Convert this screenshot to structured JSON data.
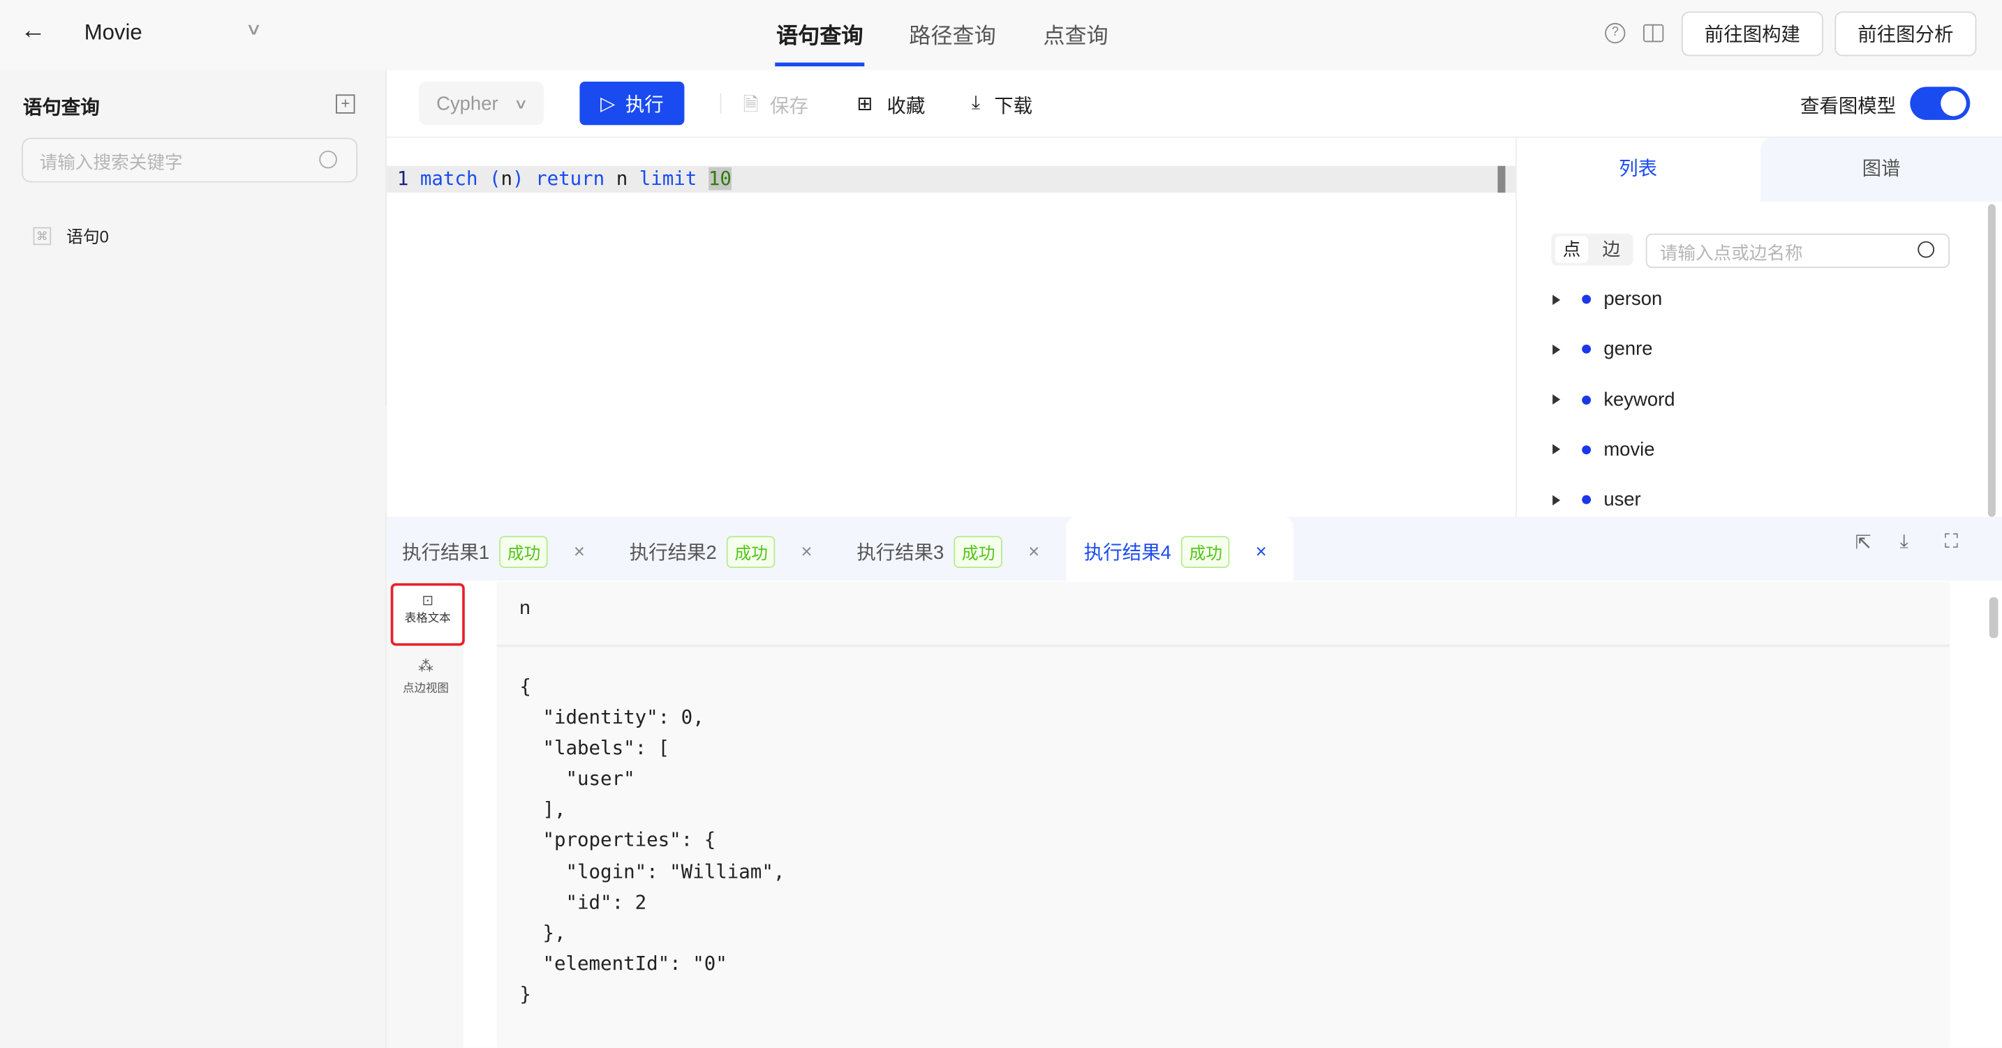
{
  "header": {
    "back_icon": "arrow-left-icon",
    "graph_name": "Movie",
    "tabs": [
      {
        "label": "语句查询",
        "active": true
      },
      {
        "label": "路径查询",
        "active": false
      },
      {
        "label": "点查询",
        "active": false
      }
    ],
    "help_icon": "question-circle-icon",
    "layout_icon": "split-layout-icon",
    "goto_build": "前往图构建",
    "goto_analysis": "前往图分析"
  },
  "sidebar": {
    "title": "语句查询",
    "add_icon": "plus-square-icon",
    "search_placeholder": "请输入搜索关键字",
    "items": [
      {
        "label": "语句0",
        "icon": "command-icon"
      }
    ]
  },
  "toolbar": {
    "language": "Cypher",
    "run": "执行",
    "save": "保存",
    "favorite": "收藏",
    "download": "下载",
    "view_model_label": "查看图模型",
    "view_model_on": true
  },
  "editor": {
    "line_number": "1",
    "tokens": [
      {
        "t": "match",
        "c": "kw"
      },
      {
        "t": " (",
        "c": "kw"
      },
      {
        "t": "n",
        "c": ""
      },
      {
        "t": ")",
        "c": "kw"
      },
      {
        "t": " return",
        "c": "kw"
      },
      {
        "t": " n ",
        "c": ""
      },
      {
        "t": "limit",
        "c": "kw"
      },
      {
        "t": " ",
        "c": ""
      },
      {
        "t": "10",
        "c": "num"
      }
    ]
  },
  "model_panel": {
    "tabs": [
      {
        "label": "列表",
        "active": true
      },
      {
        "label": "图谱",
        "active": false
      }
    ],
    "segment": [
      "点",
      "边"
    ],
    "search_placeholder": "请输入点或边名称",
    "items": [
      "person",
      "genre",
      "keyword",
      "movie",
      "user"
    ],
    "accent": "#1a37e8"
  },
  "results": {
    "tabs": [
      {
        "label": "执行结果1",
        "status": "成功"
      },
      {
        "label": "执行结果2",
        "status": "成功"
      },
      {
        "label": "执行结果3",
        "status": "成功"
      },
      {
        "label": "执行结果4",
        "status": "成功",
        "active": true
      }
    ],
    "views": [
      {
        "label": "表格文本",
        "icon": "terminal-icon",
        "active": true
      },
      {
        "label": "点边视图",
        "icon": "graph-nodes-icon"
      }
    ],
    "column": "n",
    "cell": "{\n  \"identity\": 0,\n  \"labels\": [\n    \"user\"\n  ],\n  \"properties\": {\n    \"login\": \"William\",\n    \"id\": 2\n  },\n  \"elementId\": \"0\"\n}"
  }
}
